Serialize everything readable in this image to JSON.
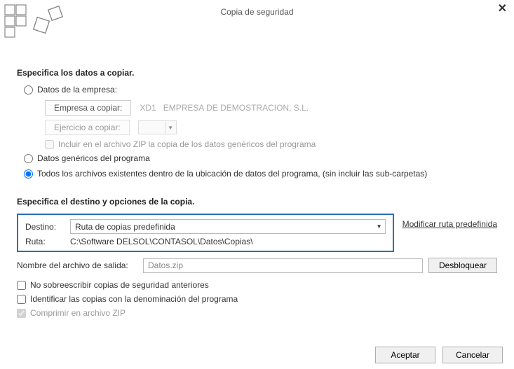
{
  "window": {
    "title": "Copia de seguridad"
  },
  "section1": {
    "title": "Especifica los datos a copiar.",
    "radio_empresa": "Datos de la empresa:",
    "empresa_btn": "Empresa a copiar:",
    "empresa_code": "XD1",
    "empresa_name": "EMPRESA DE DEMOSTRACION, S.L.",
    "ejercicio_btn": "Ejercicio a copiar:",
    "include_zip": "Incluir en el archivo ZIP la copia de los datos genéricos del programa",
    "radio_genericos": "Datos genéricos del programa",
    "radio_todos": "Todos los archivos existentes dentro de la ubicación de datos del programa, (sin incluir las sub-carpetas)"
  },
  "section2": {
    "title": "Especifica el destino y opciones de la copia.",
    "destino_label": "Destino:",
    "destino_value": "Ruta de copias predefinida",
    "modify_link": "Modificar ruta predefinida",
    "ruta_label": "Ruta:",
    "ruta_value": "C:\\Software DELSOL\\CONTASOL\\Datos\\Copias\\",
    "output_label": "Nombre del archivo de salida:",
    "output_value": "Datos.zip",
    "unlock_btn": "Desbloquear",
    "no_overwrite": "No sobreescribir copias de seguridad anteriores",
    "identify": "Identificar las copias con la denominación del programa",
    "compress": "Comprimir en archivo ZIP"
  },
  "buttons": {
    "accept": "Aceptar",
    "cancel": "Cancelar"
  }
}
